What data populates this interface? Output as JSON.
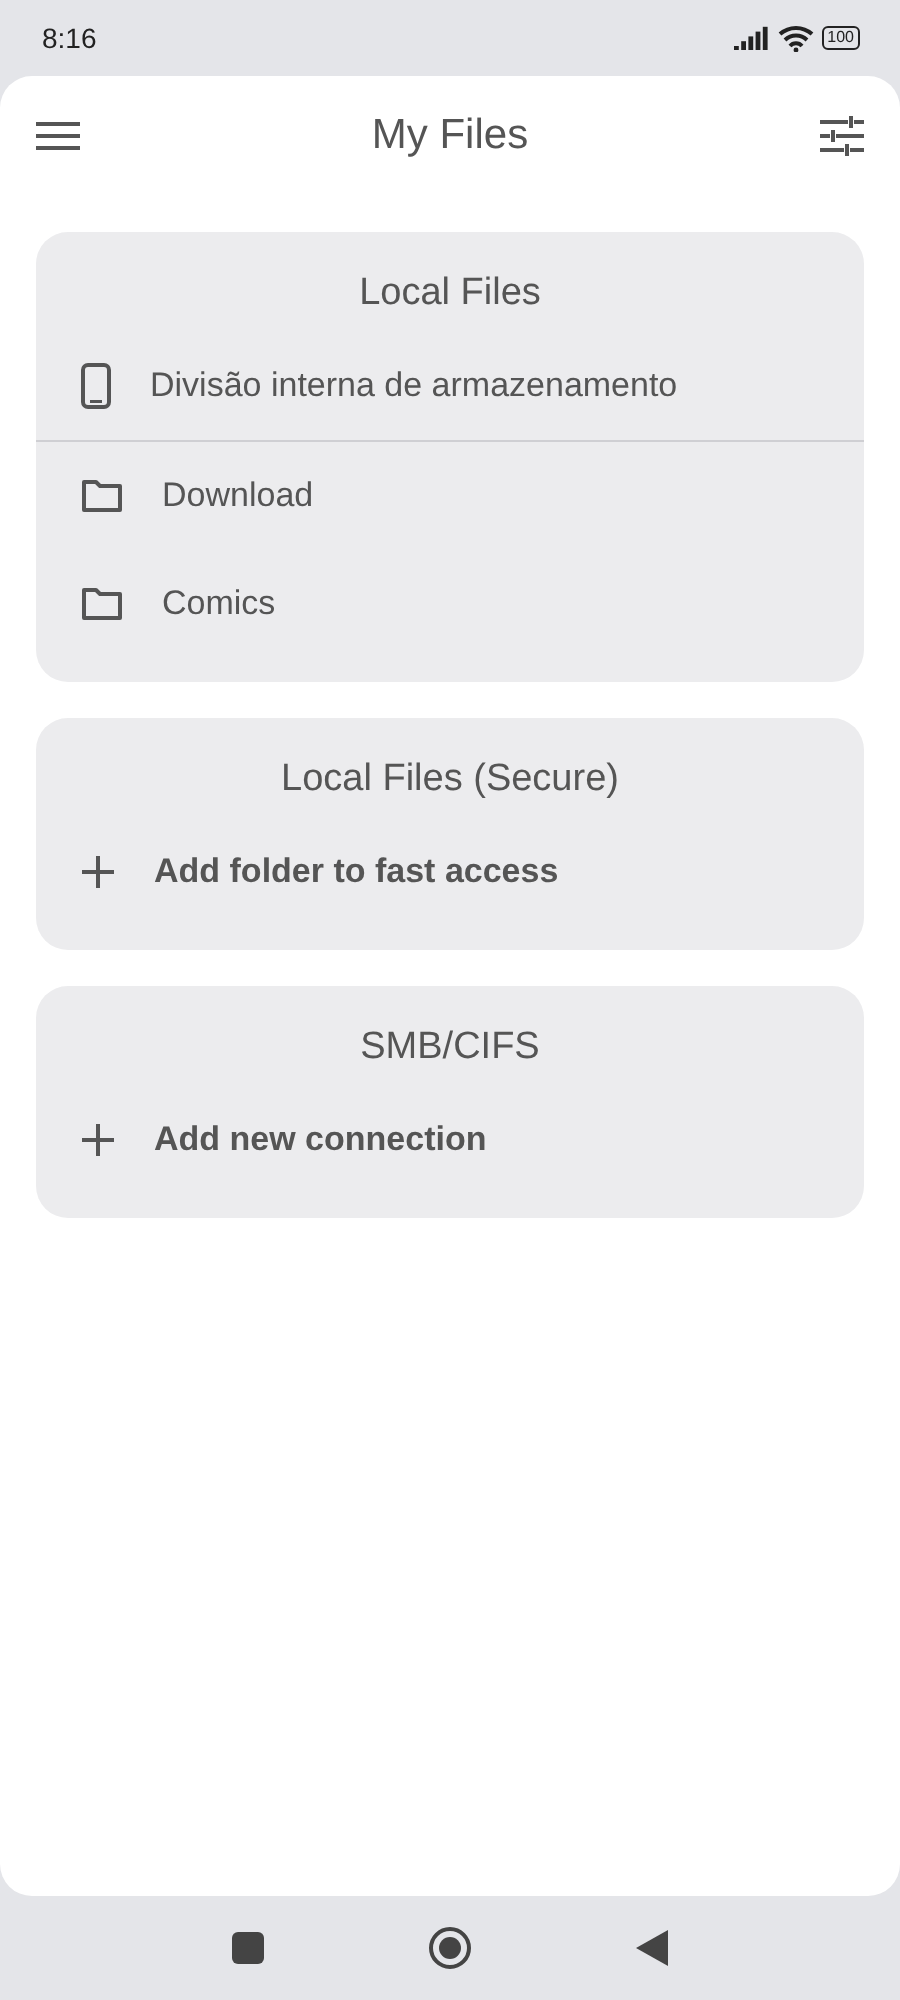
{
  "status_bar": {
    "time": "8:16",
    "battery": "100"
  },
  "app_bar": {
    "title": "My Files"
  },
  "sections": [
    {
      "title": "Local Files",
      "items": [
        {
          "kind": "device",
          "label": "Divisão interna de armazenamento"
        },
        {
          "kind": "folder",
          "label": "Download"
        },
        {
          "kind": "folder",
          "label": "Comics"
        }
      ]
    },
    {
      "title": "Local Files (Secure)",
      "items": [
        {
          "kind": "add",
          "label": "Add folder to fast access"
        }
      ]
    },
    {
      "title": "SMB/CIFS",
      "items": [
        {
          "kind": "add",
          "label": "Add new connection"
        }
      ]
    }
  ]
}
